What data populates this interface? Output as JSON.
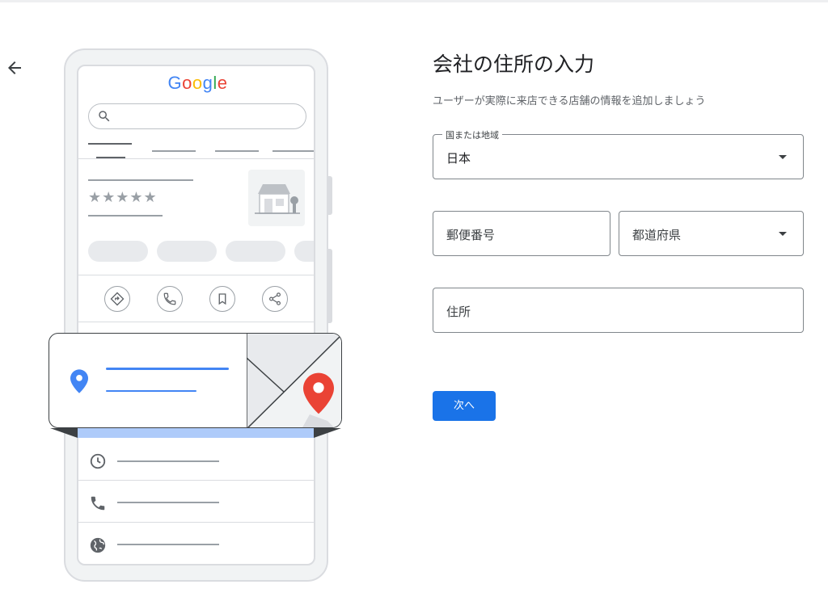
{
  "form": {
    "title": "会社の住所の入力",
    "subtitle": "ユーザーが実際に来店できる店舗の情報を追加しましょう",
    "country_label": "国または地域",
    "country_value": "日本",
    "postal_placeholder": "郵便番号",
    "prefecture_placeholder": "都道府県",
    "address_placeholder": "住所",
    "next_label": "次へ"
  },
  "illustration": {
    "logo": {
      "G": "G",
      "o1": "o",
      "o2": "o",
      "g": "g",
      "l": "l",
      "e": "e"
    },
    "stars": "★★★★★"
  },
  "colors": {
    "primary": "#1a73e8",
    "pin_blue": "#4285f4",
    "pin_red": "#ea4335",
    "band": "#aecbfa"
  },
  "icons": [
    "back-arrow-icon",
    "search-icon",
    "directions-icon",
    "phone-icon",
    "bookmark-icon",
    "share-icon",
    "location-pin-icon",
    "map-pin-icon",
    "clock-icon",
    "globe-icon",
    "dropdown-caret-icon"
  ]
}
